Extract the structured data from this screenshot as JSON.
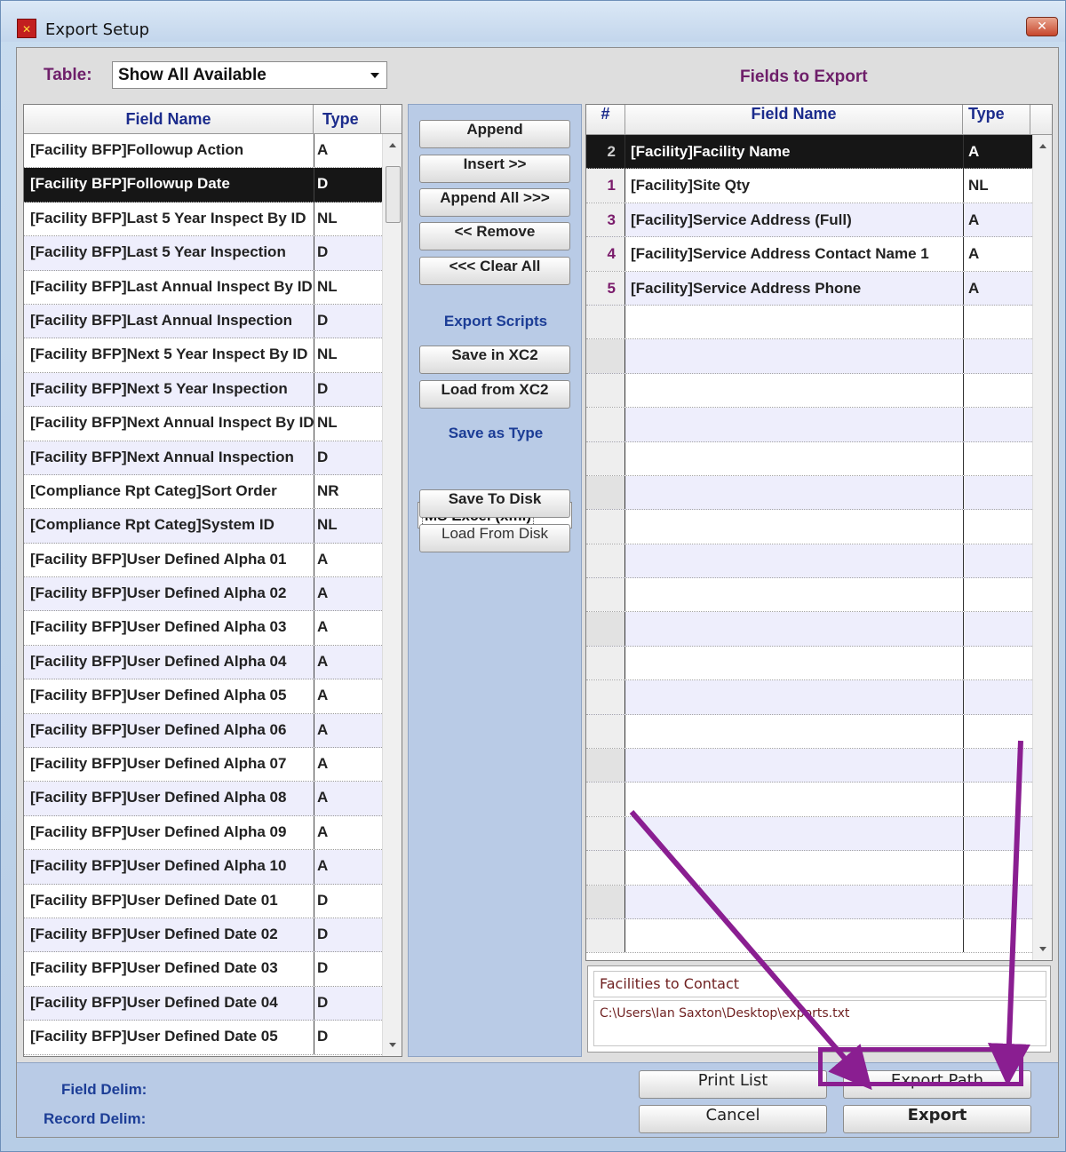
{
  "window": {
    "title": "Export Setup",
    "icon": "xc-app-icon",
    "close_label": "✕"
  },
  "table_selector": {
    "label": "Table:",
    "value": "Show All Available"
  },
  "fields_to_export_title": "Fields to Export",
  "available_fields": {
    "columns": [
      "Field Name",
      "Type"
    ],
    "rows": [
      {
        "name": "[Facility BFP]Followup Action",
        "type": "A"
      },
      {
        "name": "[Facility BFP]Followup Date",
        "type": "D",
        "selected": true
      },
      {
        "name": "[Facility BFP]Last 5 Year Inspect By ID",
        "type": "NL"
      },
      {
        "name": "[Facility BFP]Last 5 Year Inspection",
        "type": "D"
      },
      {
        "name": "[Facility BFP]Last Annual Inspect By ID",
        "type": "NL"
      },
      {
        "name": "[Facility BFP]Last Annual Inspection",
        "type": "D"
      },
      {
        "name": "[Facility BFP]Next 5 Year Inspect By ID",
        "type": "NL"
      },
      {
        "name": "[Facility BFP]Next 5 Year Inspection",
        "type": "D"
      },
      {
        "name": "[Facility BFP]Next Annual Inspect By ID",
        "type": "NL"
      },
      {
        "name": "[Facility BFP]Next Annual Inspection",
        "type": "D"
      },
      {
        "name": "[Compliance Rpt Categ]Sort Order",
        "type": "NR"
      },
      {
        "name": "[Compliance Rpt Categ]System ID",
        "type": "NL"
      },
      {
        "name": "[Facility BFP]User Defined Alpha 01",
        "type": "A"
      },
      {
        "name": "[Facility BFP]User Defined Alpha 02",
        "type": "A"
      },
      {
        "name": "[Facility BFP]User Defined Alpha 03",
        "type": "A"
      },
      {
        "name": "[Facility BFP]User Defined Alpha 04",
        "type": "A"
      },
      {
        "name": "[Facility BFP]User Defined Alpha 05",
        "type": "A"
      },
      {
        "name": "[Facility BFP]User Defined Alpha 06",
        "type": "A"
      },
      {
        "name": "[Facility BFP]User Defined Alpha 07",
        "type": "A"
      },
      {
        "name": "[Facility BFP]User Defined Alpha 08",
        "type": "A"
      },
      {
        "name": "[Facility BFP]User Defined Alpha 09",
        "type": "A"
      },
      {
        "name": "[Facility BFP]User Defined Alpha 10",
        "type": "A"
      },
      {
        "name": "[Facility BFP]User Defined Date 01",
        "type": "D"
      },
      {
        "name": "[Facility BFP]User Defined Date 02",
        "type": "D"
      },
      {
        "name": "[Facility BFP]User Defined Date 03",
        "type": "D"
      },
      {
        "name": "[Facility BFP]User Defined Date 04",
        "type": "D"
      },
      {
        "name": "[Facility BFP]User Defined Date 05",
        "type": "D"
      }
    ]
  },
  "middle_panel": {
    "append": "Append",
    "insert": "Insert >>",
    "append_all": "Append All >>>",
    "remove": "<< Remove",
    "clear_all": "<<< Clear All",
    "export_scripts_label": "Export Scripts",
    "save_in_xc2": "Save in XC2",
    "load_from_xc2": "Load from XC2",
    "save_as_type_label": "Save as Type",
    "save_as_type_value": "MS Excel (xml)",
    "save_to_disk": "Save To Disk",
    "load_from_disk": "Load From Disk"
  },
  "export_fields": {
    "columns": [
      "#",
      "Field Name",
      "Type"
    ],
    "rows": [
      {
        "num": "2",
        "name": "[Facility]Facility Name",
        "type": "A",
        "selected": true
      },
      {
        "num": "1",
        "name": "[Facility]Site Qty",
        "type": "NL"
      },
      {
        "num": "3",
        "name": "[Facility]Service Address (Full)",
        "type": "A"
      },
      {
        "num": "4",
        "name": "[Facility]Service Address Contact Name 1",
        "type": "A"
      },
      {
        "num": "5",
        "name": "[Facility]Service Address Phone",
        "type": "A"
      }
    ],
    "empty_rows": 19
  },
  "export_info": {
    "name": "Facilities to Contact",
    "path": "C:\\Users\\Ian Saxton\\Desktop\\exports.txt"
  },
  "bottom_bar": {
    "field_delim_label": "Field Delim:",
    "record_delim_label": "Record Delim:",
    "print_list": "Print List",
    "export_path": "Export Path",
    "cancel": "Cancel",
    "export": "Export"
  },
  "annotation_color": "#8a1e91"
}
